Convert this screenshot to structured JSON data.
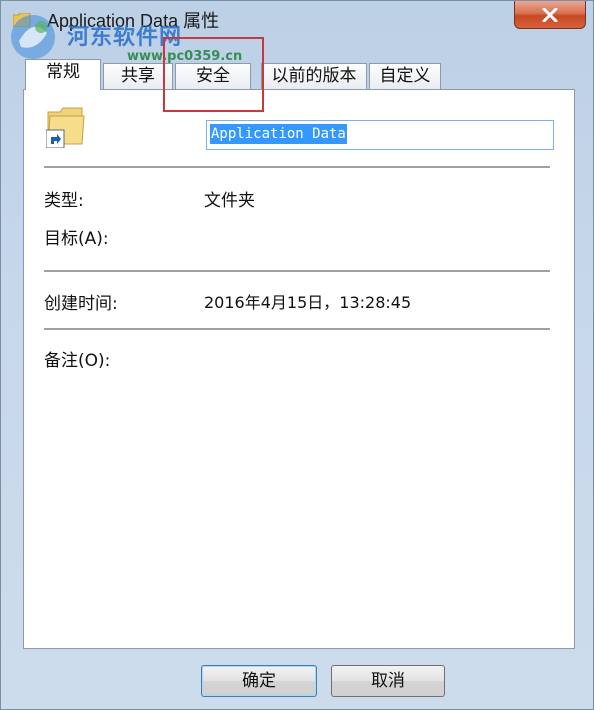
{
  "window": {
    "title": "Application Data 属性",
    "close_label": "✕"
  },
  "watermark": {
    "line1": "河东软件网",
    "line2": "www.pc0359.cn"
  },
  "tabs": [
    {
      "label": "常规",
      "active": true
    },
    {
      "label": "共享",
      "active": false
    },
    {
      "label": "安全",
      "active": false
    },
    {
      "label": "以前的版本",
      "active": false
    },
    {
      "label": "自定义",
      "active": false
    }
  ],
  "general": {
    "name_value": "Application Data",
    "type_label": "类型:",
    "type_value": "文件夹",
    "target_label": "目标(A):",
    "created_label": "创建时间:",
    "created_value": "2016年4月15日，13:28:45",
    "comment_label": "备注(O):"
  },
  "buttons": {
    "ok": "确定",
    "cancel": "取消"
  },
  "colors": {
    "highlight_box": "#c8383c",
    "selection": "#3399ff",
    "close_button": "#c44a23"
  }
}
